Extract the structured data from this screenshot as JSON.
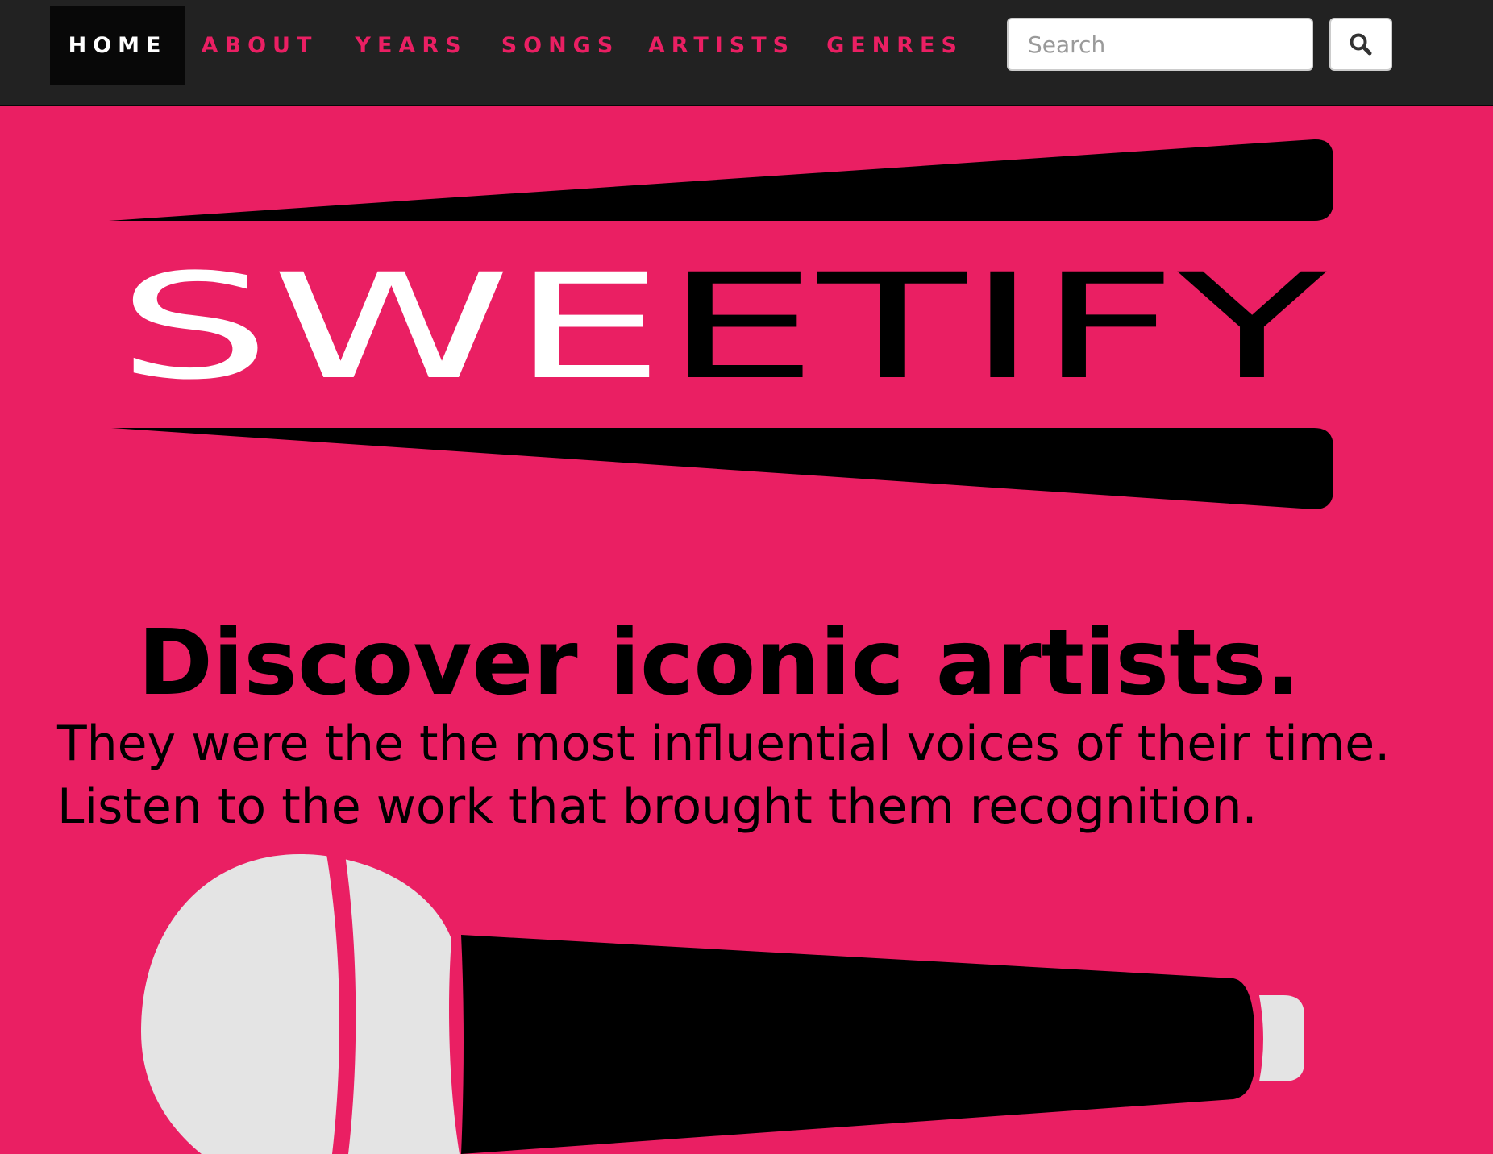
{
  "nav": {
    "items": [
      {
        "label": "HOME",
        "active": true
      },
      {
        "label": "ABOUT",
        "active": false
      },
      {
        "label": "YEARS",
        "active": false
      },
      {
        "label": "SONGS",
        "active": false
      },
      {
        "label": "ARTISTS",
        "active": false
      },
      {
        "label": "GENRES",
        "active": false
      }
    ],
    "search_placeholder": "Search",
    "search_icon": "magnifier-icon"
  },
  "logo": {
    "text": "SWEETIFY",
    "white_letters": "SWE",
    "black_letters": "ETIFY"
  },
  "hero": {
    "headline": "Discover iconic artists.",
    "line1": "They were the the most influential voices of their time.",
    "line2": "Listen to the work that brought them recognition."
  },
  "colors": {
    "brand_pink": "#ea1f63",
    "navbar_bg": "#222222",
    "active_tab_bg": "#080808",
    "mic_head": "#e4e4e4",
    "mic_body": "#000000"
  },
  "illustration": {
    "icon": "microphone-icon"
  }
}
